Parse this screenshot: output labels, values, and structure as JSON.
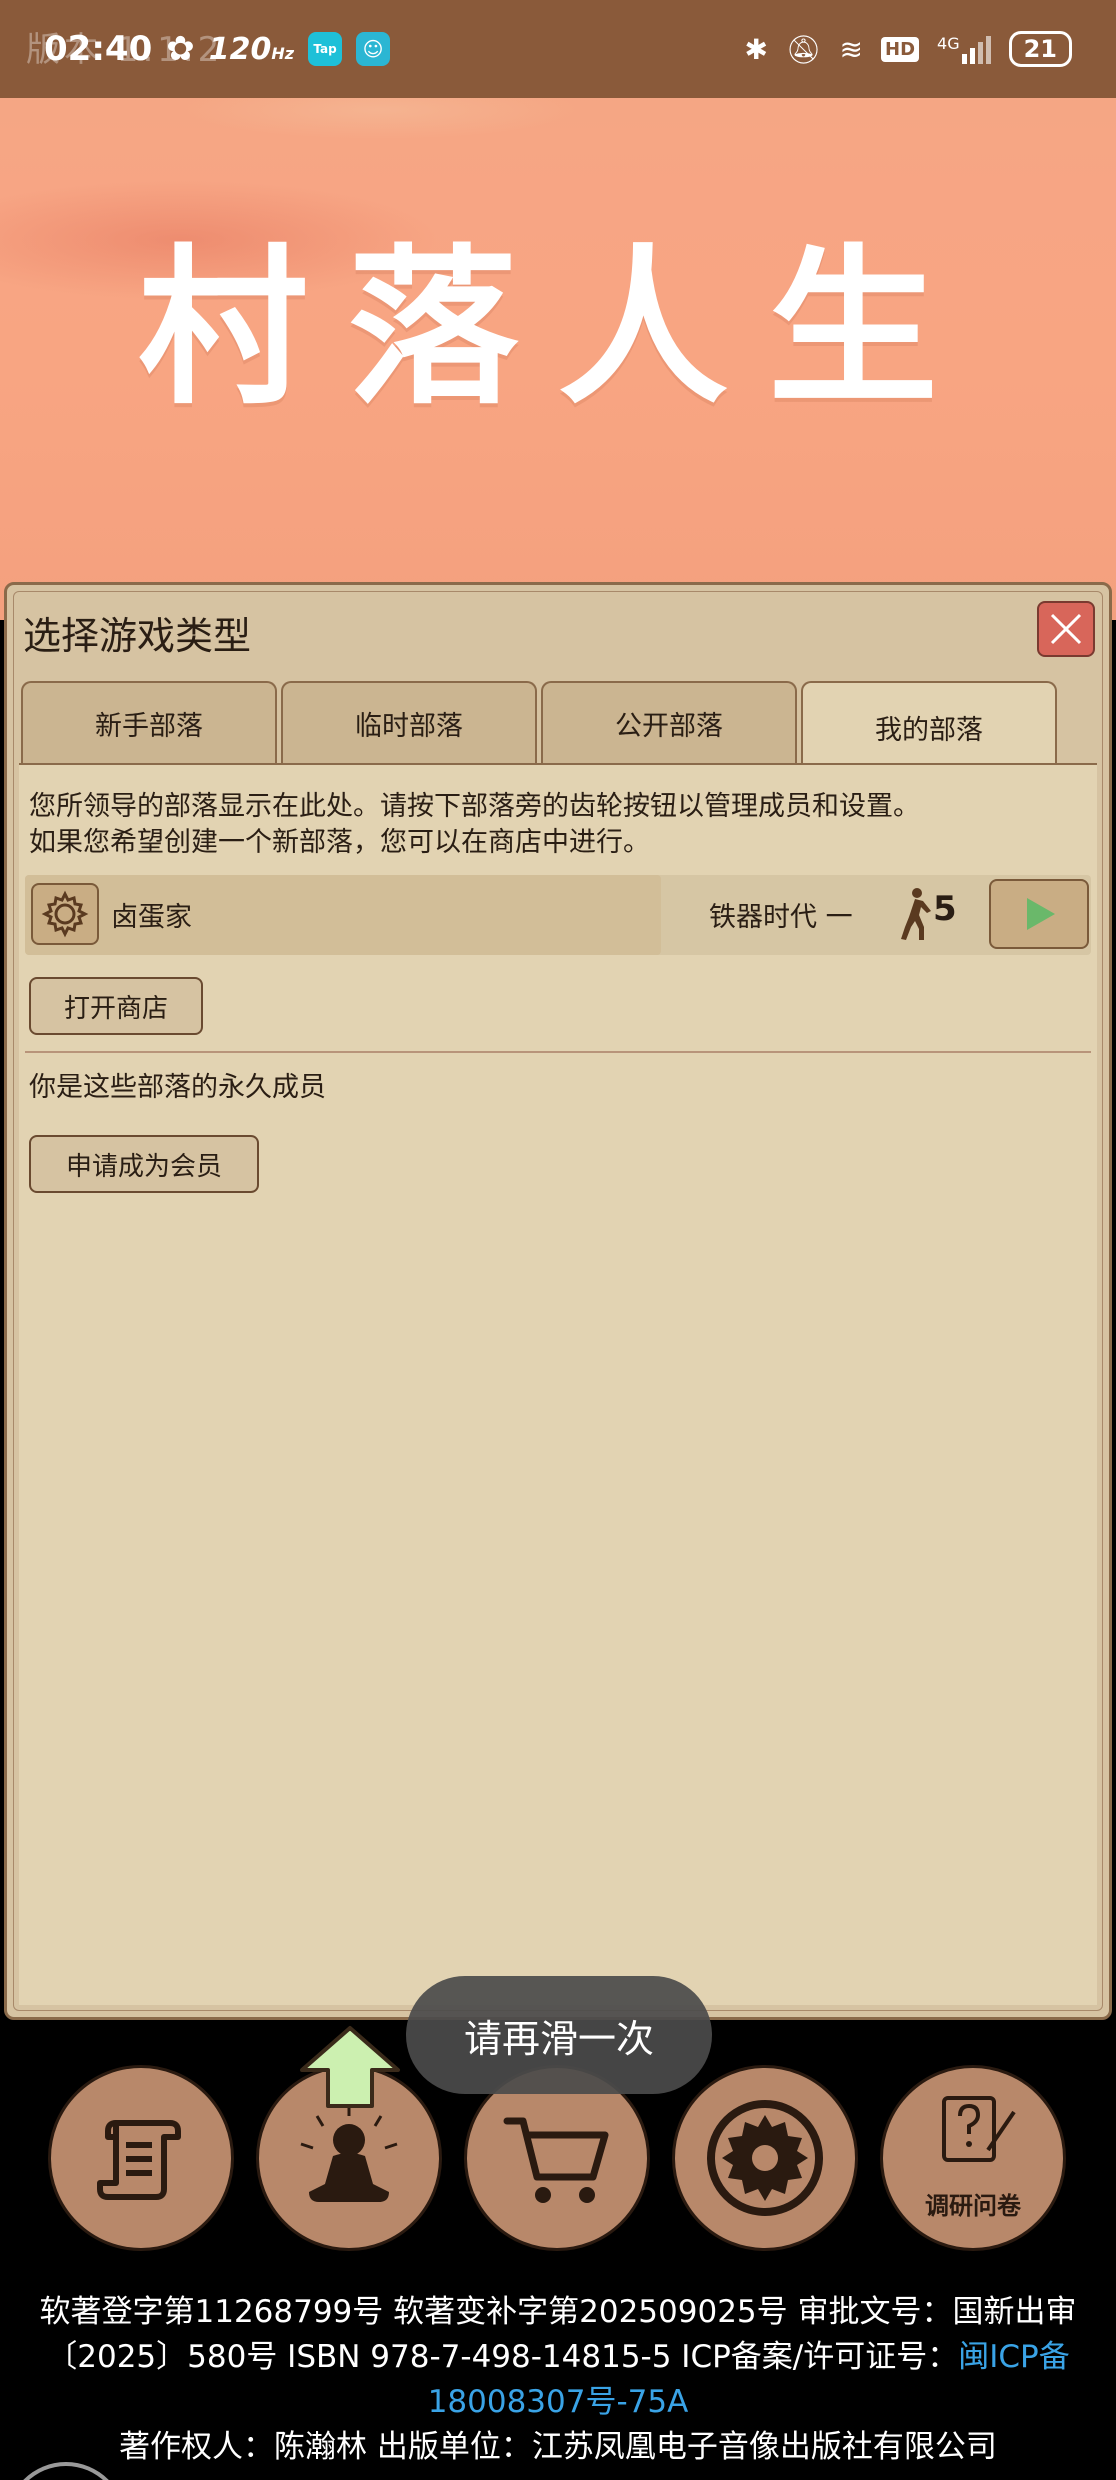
{
  "status_bar": {
    "ghost_text": "版本 1.1.2",
    "time": "02:40",
    "refresh_rate": "120",
    "refresh_unit": "Hz",
    "app_icons": [
      "Tap",
      "app"
    ],
    "hd": "HD",
    "network": "4G",
    "battery": "21"
  },
  "game_title": "村落人生",
  "panel": {
    "title": "选择游戏类型",
    "tabs": [
      {
        "label": "新手部落",
        "active": false
      },
      {
        "label": "临时部落",
        "active": false
      },
      {
        "label": "公开部落",
        "active": false
      },
      {
        "label": "我的部落",
        "active": true
      }
    ],
    "description_line1": "您所领导的部落显示在此处。请按下部落旁的齿轮按钮以管理成员和设置。",
    "description_line2": "如果您希望创建一个新部落，您可以在商店中进行。",
    "tribe": {
      "name": "卤蛋家",
      "era": "铁器时代 一",
      "members": "5"
    },
    "open_shop_label": "打开商店",
    "member_text": "你是这些部落的永久成员",
    "apply_member_label": "申请成为会员"
  },
  "toast": "请再滑一次",
  "nav": {
    "survey_label": "调研问卷",
    "items": [
      "scroll-icon",
      "meditate-icon",
      "cart-icon",
      "gear-icon",
      "survey-icon"
    ]
  },
  "footer": {
    "line1": "软著登字第11268799号 软著变补字第202509025号 审批文号：国新出审",
    "line2_prefix": "〔2025〕580号 ISBN 978-7-498-14815-5 ICP备案/许可证号：",
    "line2_link": "闽ICP备",
    "line3_link": "18008307号-75A",
    "line4": "著作权人：陈瀚林 出版单位：江苏凤凰电子音像出版社有限公司"
  },
  "colors": {
    "status_bar": "#8a5a3a",
    "hero": "#f8a582",
    "panel": "#d6c3a2",
    "content": "#e2d3b2",
    "close_button": "#d8665a",
    "play_arrow": "#6ab86a",
    "link": "#3aa3e6",
    "nav_button": "#b8886a"
  }
}
